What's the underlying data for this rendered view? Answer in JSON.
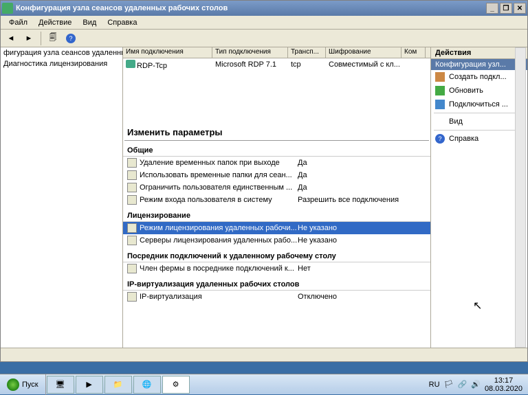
{
  "title": "Конфигурация узла сеансов удаленных рабочих столов",
  "menu": {
    "file": "Файл",
    "action": "Действие",
    "view": "Вид",
    "help": "Справка"
  },
  "left": {
    "item0": "фигурация узла сеансов удаленны",
    "item1": "Диагностика лицензирования"
  },
  "gridhdr": {
    "c0": "Имя подключения",
    "c1": "Тип подключения",
    "c2": "Трансп...",
    "c3": "Шифрование",
    "c4": "Ком"
  },
  "conn": {
    "name": "RDP-Tcp",
    "type": "Microsoft RDP 7.1",
    "transport": "tcp",
    "enc": "Совместимый с кл..."
  },
  "paramtitle": "Изменить параметры",
  "sec": {
    "general": "Общие",
    "licensing": "Лицензирование",
    "broker": "Посредник подключений к удаленному рабочему столу",
    "ipvirt": "IP-виртуализация удаленных рабочих столов"
  },
  "p": {
    "p0n": "Удаление временных папок при выходе",
    "p0v": "Да",
    "p1n": "Использовать временные папки для сеан...",
    "p1v": "Да",
    "p2n": "Ограничить пользователя единственным ...",
    "p2v": "Да",
    "p3n": "Режим входа пользователя в систему",
    "p3v": "Разрешить все подключения",
    "p4n": "Режим лицензирования удаленных рабочи...",
    "p4v": "Не указано",
    "p5n": "Серверы лицензирования удаленных рабо...",
    "p5v": "Не указано",
    "p6n": "Член фермы в посреднике подключений к...",
    "p6v": "Нет",
    "p7n": "IP-виртуализация",
    "p7v": "Отключено"
  },
  "actions": {
    "hdr": "Действия",
    "sub": "Конфигурация узл...",
    "a0": "Создать подкл...",
    "a1": "Обновить",
    "a2": "Подключиться ...",
    "a3": "Вид",
    "a4": "Справка"
  },
  "taskbar": {
    "start": "Пуск",
    "lang": "RU",
    "time": "13:17",
    "date": "08.03.2020"
  }
}
